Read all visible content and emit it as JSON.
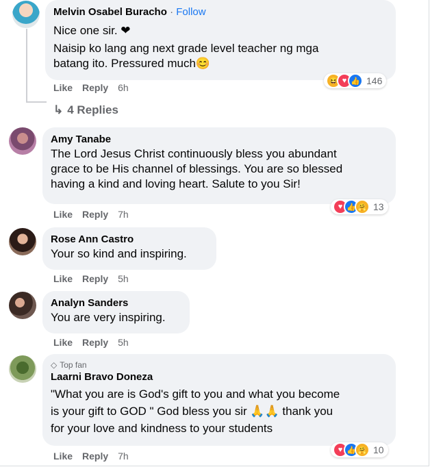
{
  "comments": [
    {
      "name": "Melvin Osabel Buracho",
      "separator": "·",
      "follow": "Follow",
      "lines": [
        "Nice one sir. ❤",
        "Naisip ko lang ang next grade level teacher ng mga",
        "batang ito. Pressured much😊"
      ],
      "like": "Like",
      "reply": "Reply",
      "time": "6h",
      "reactions": [
        "haha-icon",
        "love-icon",
        "like-icon"
      ],
      "reaction_count": "146",
      "replies_label": "4 Replies"
    },
    {
      "name": "Amy Tanabe",
      "lines": [
        "The Lord Jesus Christ continuously bless you abundant",
        "grace to be His channel of blessings. You are so blessed",
        "having a kind and loving heart. Salute to you Sir!"
      ],
      "like": "Like",
      "reply": "Reply",
      "time": "7h",
      "reactions": [
        "love-icon",
        "like-icon",
        "care-icon"
      ],
      "reaction_count": "13"
    },
    {
      "name": "Rose Ann Castro",
      "lines": [
        "Your so kind and inspiring."
      ],
      "like": "Like",
      "reply": "Reply",
      "time": "5h"
    },
    {
      "name": "Analyn Sanders",
      "lines": [
        "You are very inspiring."
      ],
      "like": "Like",
      "reply": "Reply",
      "time": "5h"
    },
    {
      "badge": "Top fan",
      "name": "Laarni Bravo Doneza",
      "lines": [
        "\"What you are is God's gift to you and what you become",
        "is your gift to GOD \" God bless you sir 🙏🙏 thank you",
        "for your love and kindness to your students"
      ],
      "like": "Like",
      "reply": "Reply",
      "time": "7h",
      "reactions": [
        "love-icon",
        "like-icon",
        "care-icon"
      ],
      "reaction_count": "10"
    }
  ],
  "colors": {
    "bubble": "#f0f2f5",
    "link": "#1877f2",
    "meta": "#65676b"
  }
}
